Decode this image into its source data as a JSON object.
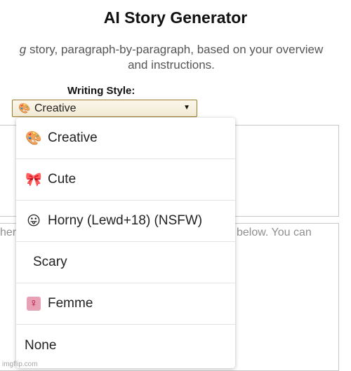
{
  "header": {
    "title": "AI Story Generator",
    "description_line1_emphasis": "g",
    "description_line1_rest": " story, paragraph-by-paragraph, based on your overview",
    "description_line2": "and instructions."
  },
  "writing_style": {
    "label": "Writing Style:",
    "selected_icon": "🎨",
    "selected_value": "Creative",
    "caret": "▼",
    "options": [
      {
        "icon": "🎨",
        "label": "Creative"
      },
      {
        "icon": "🎀",
        "label": "Cute"
      },
      {
        "icon": "😛",
        "label": "Horny (Lewd+18) (NSFW)"
      },
      {
        "icon": "",
        "label": "Scary"
      },
      {
        "icon": "♀",
        "label": "Femme"
      },
      {
        "icon": "",
        "label": "None"
      }
    ]
  },
  "instructions_box": {
    "placeholder_left": "her",
    "placeholder_right": "below. You can"
  },
  "watermark": "imgflip.com"
}
